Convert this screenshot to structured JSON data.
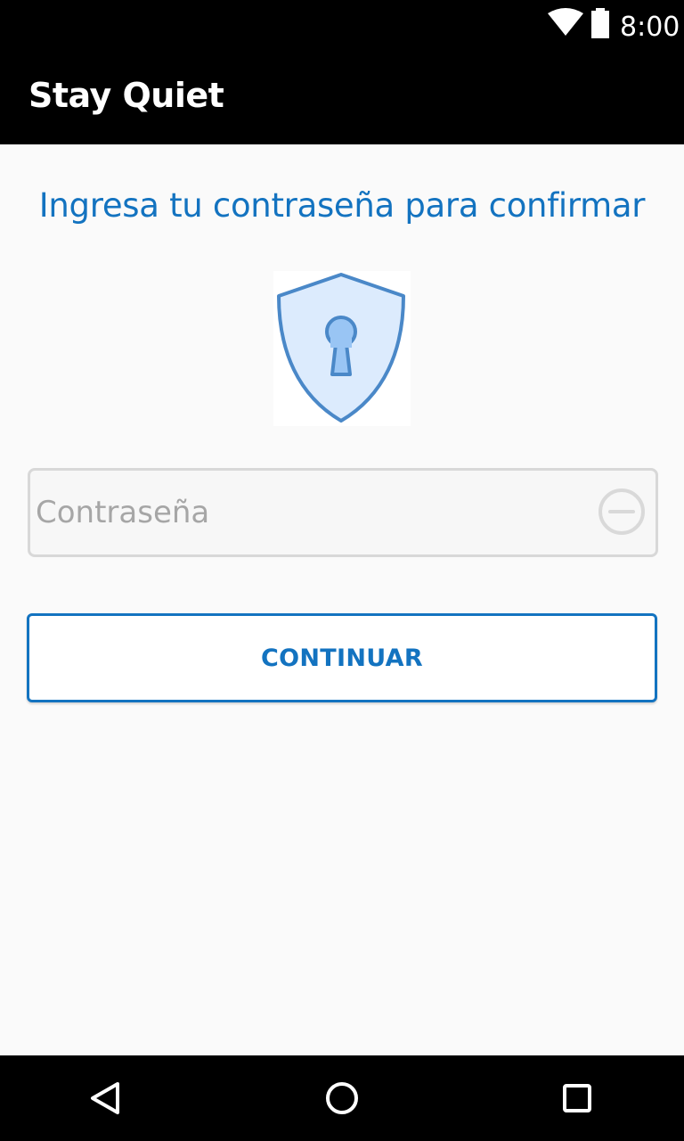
{
  "status_bar": {
    "time": "8:00",
    "icons": [
      "wifi-icon",
      "battery-icon"
    ]
  },
  "app_bar": {
    "title": "Stay Quiet"
  },
  "main": {
    "heading": "Ingresa tu contraseña para confirmar",
    "illustration_icon": "shield-keyhole-icon",
    "password_field": {
      "value": "",
      "placeholder": "Contraseña",
      "clear_icon": "clear-icon"
    },
    "continue_label": "CONTINUAR"
  },
  "nav_bar": {
    "icons": [
      "back-icon",
      "home-icon",
      "recents-icon"
    ]
  },
  "colors": {
    "accent": "#1373c0",
    "shield_stroke": "#4a88c8",
    "shield_fill": "#dcebfd",
    "keyhole_fill": "#99c5f4"
  }
}
